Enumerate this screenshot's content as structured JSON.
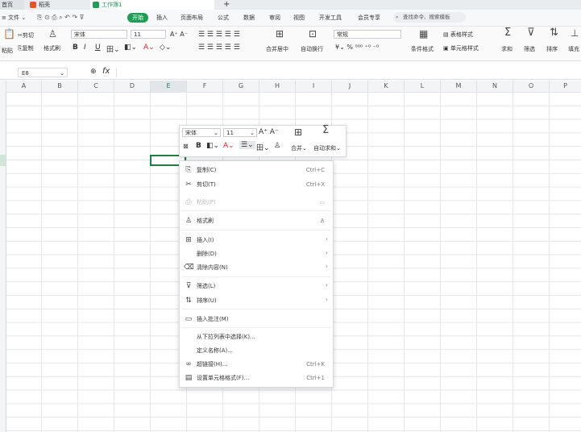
{
  "titlebar": {
    "tabs": [
      {
        "label": "首页",
        "color": "#2f6fde"
      },
      {
        "label": "稻壳",
        "color": "#e8532d"
      },
      {
        "label": "工作簿1",
        "color": "#1f9d55"
      }
    ],
    "new_tab": "+"
  },
  "menubar": {
    "file": "文件",
    "items": [
      "开始",
      "插入",
      "页面布局",
      "公式",
      "数据",
      "审阅",
      "视图",
      "开发工具",
      "会员专享"
    ],
    "search_placeholder": "查找命令、搜索模板"
  },
  "ribbon": {
    "paste_label": "粘贴",
    "cut_label": "剪切",
    "copy_label": "复制",
    "format_painter_label": "格式刷",
    "font_name": "宋体",
    "font_size": "11",
    "merge_label": "合并居中",
    "wrap_label": "自动换行",
    "number_format": "常规",
    "percent_label": "%",
    "cond_format_label": "条件格式",
    "table_style_label": "表格样式",
    "cell_style_label": "单元格样式",
    "sum_label": "求和",
    "filter_label": "筛选",
    "sort_label": "排序",
    "fill_label": "填充"
  },
  "formulabar": {
    "cell_ref": "E8",
    "fx": "fx"
  },
  "columns": [
    "A",
    "B",
    "C",
    "D",
    "E",
    "F",
    "G",
    "H",
    "I",
    "J",
    "K",
    "L",
    "M",
    "N",
    "O",
    "P"
  ],
  "minitoolbar": {
    "font_name": "宋体",
    "font_size": "11",
    "merge_label": "合并",
    "autosum_label": "自动求和"
  },
  "context_menu": {
    "items": [
      {
        "label": "复制(C)",
        "shortcut": "Ctrl+C",
        "icon": "copy-icon"
      },
      {
        "label": "剪切(T)",
        "shortcut": "Ctrl+X",
        "icon": "scissors-icon"
      },
      {
        "label": "粘贴(P)",
        "shortcut": "",
        "icon": "paste-icon"
      },
      {
        "label": "格式刷",
        "shortcut": "",
        "icon": "format-painter-icon"
      },
      {
        "label": "插入(I)",
        "shortcut": "",
        "icon": "insert-icon"
      },
      {
        "label": "删除(D)",
        "shortcut": "",
        "icon": ""
      },
      {
        "label": "清除内容(N)",
        "shortcut": "",
        "icon": "eraser-icon"
      },
      {
        "label": "筛选(L)",
        "shortcut": "",
        "icon": "filter-icon"
      },
      {
        "label": "排序(U)",
        "shortcut": "",
        "icon": "sort-icon"
      },
      {
        "label": "插入批注(M)",
        "shortcut": "",
        "icon": "comment-icon"
      },
      {
        "label": "从下拉列表中选择(K)...",
        "shortcut": "",
        "icon": ""
      },
      {
        "label": "定义名称(A)...",
        "shortcut": "",
        "icon": ""
      },
      {
        "label": "超链接(H)...",
        "shortcut": "Ctrl+K",
        "icon": "link-icon"
      },
      {
        "label": "设置单元格格式(F)...",
        "shortcut": "Ctrl+1",
        "icon": "cell-format-icon"
      }
    ]
  }
}
